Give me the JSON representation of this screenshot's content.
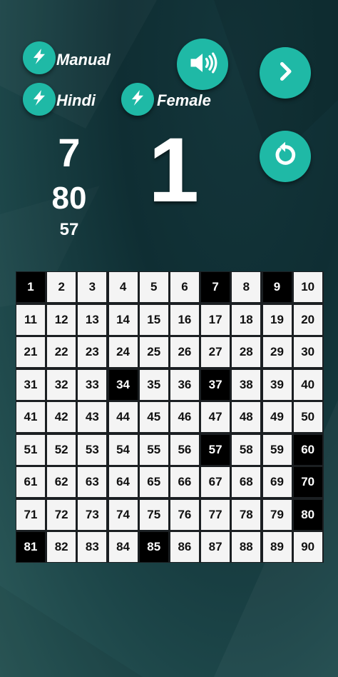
{
  "options": {
    "mode_label": "Manual",
    "language_label": "Hindi",
    "voice_label": "Female"
  },
  "icons": {
    "option": "lightning-bolt-icon",
    "sound": "speaker-volume-icon",
    "next": "chevron-right-icon",
    "reset": "refresh-icon"
  },
  "colors": {
    "accent": "#1fb9a6",
    "called_cell": "#000000",
    "uncalled_cell": "#f4f4f4"
  },
  "status": {
    "previous_1": "7",
    "previous_2": "80",
    "previous_3": "57",
    "current_number": "1"
  },
  "board": {
    "numbers": [
      "1",
      "2",
      "3",
      "4",
      "5",
      "6",
      "7",
      "8",
      "9",
      "10",
      "11",
      "12",
      "13",
      "14",
      "15",
      "16",
      "17",
      "18",
      "19",
      "20",
      "21",
      "22",
      "23",
      "24",
      "25",
      "26",
      "27",
      "28",
      "29",
      "30",
      "31",
      "32",
      "33",
      "34",
      "35",
      "36",
      "37",
      "38",
      "39",
      "40",
      "41",
      "42",
      "43",
      "44",
      "45",
      "46",
      "47",
      "48",
      "49",
      "50",
      "51",
      "52",
      "53",
      "54",
      "55",
      "56",
      "57",
      "58",
      "59",
      "60",
      "61",
      "62",
      "63",
      "64",
      "65",
      "66",
      "67",
      "68",
      "69",
      "70",
      "71",
      "72",
      "73",
      "74",
      "75",
      "76",
      "77",
      "78",
      "79",
      "80",
      "81",
      "82",
      "83",
      "84",
      "85",
      "86",
      "87",
      "88",
      "89",
      "90"
    ],
    "called": [
      1,
      7,
      9,
      34,
      37,
      57,
      60,
      70,
      80,
      81,
      85
    ]
  }
}
